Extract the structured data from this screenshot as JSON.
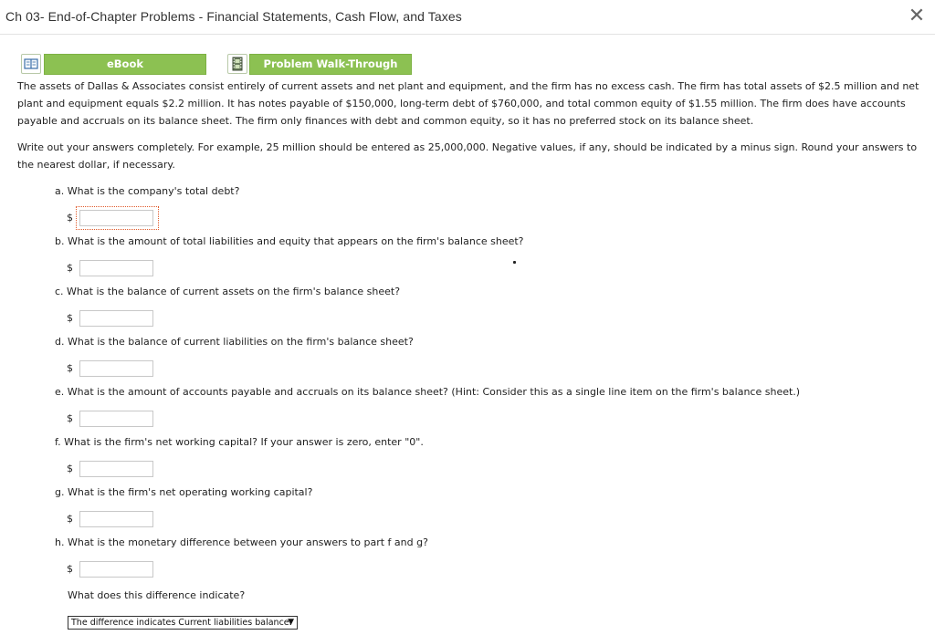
{
  "window": {
    "title": "Ch 03- End-of-Chapter Problems - Financial Statements, Cash Flow, and Taxes",
    "close_glyph": "✕"
  },
  "toolbar": {
    "ebook_label": "eBook",
    "walkthrough_label": "Problem Walk-Through"
  },
  "problem": {
    "intro_lines": [
      "The assets of Dallas & Associates consist entirely of current assets and net plant and equipment, and the firm has no excess cash. The firm has total assets of $2.5 million and net",
      "plant and equipment equals $2.2 million. It has notes payable of $150,000, long-term debt of $760,000, and total common equity of $1.55 million. The firm does have accounts",
      "payable and accruals on its balance sheet. The firm only finances with debt and common equity, so it has no preferred stock on its balance sheet."
    ],
    "instruction_lines": [
      "Write out your answers completely. For example, 25 million should be entered as 25,000,000. Negative values, if any, should be indicated by a minus sign. Round your answers to",
      "the nearest dollar, if necessary."
    ]
  },
  "questions": [
    {
      "text": "a. What is the company's total debt?",
      "currency": "$",
      "value": ""
    },
    {
      "text": "b. What is the amount of total liabilities and equity that appears on the firm's balance sheet?",
      "currency": "$",
      "value": ""
    },
    {
      "text": "c. What is the balance of current assets on the firm's balance sheet?",
      "currency": "$",
      "value": ""
    },
    {
      "text": "d. What is the balance of current liabilities on the firm's balance sheet?",
      "currency": "$",
      "value": ""
    },
    {
      "text": "e. What is the amount of accounts payable and accruals on its balance sheet? (Hint: Consider this as a single line item on the firm's balance sheet.)",
      "currency": "$",
      "value": ""
    },
    {
      "text": "f. What is the firm's net working capital? If your answer is zero, enter \"0\".",
      "currency": "$",
      "value": ""
    },
    {
      "text": "g. What is the firm's net operating working capital?",
      "currency": "$",
      "value": ""
    },
    {
      "text": "h. What is the monetary difference between your answers to part f and g?",
      "currency": "$",
      "value": ""
    }
  ],
  "followup": {
    "question": "What does this difference indicate?",
    "selected_option": "The difference indicates Current liabilities balance."
  },
  "colors": {
    "button_green": "#8cc152",
    "focus_orange": "#e05a2b"
  },
  "icons": {
    "ebook": "open-book-icon",
    "walkthrough": "film-strip-icon",
    "close": "close-icon",
    "dropdown": "chevron-down-icon"
  }
}
